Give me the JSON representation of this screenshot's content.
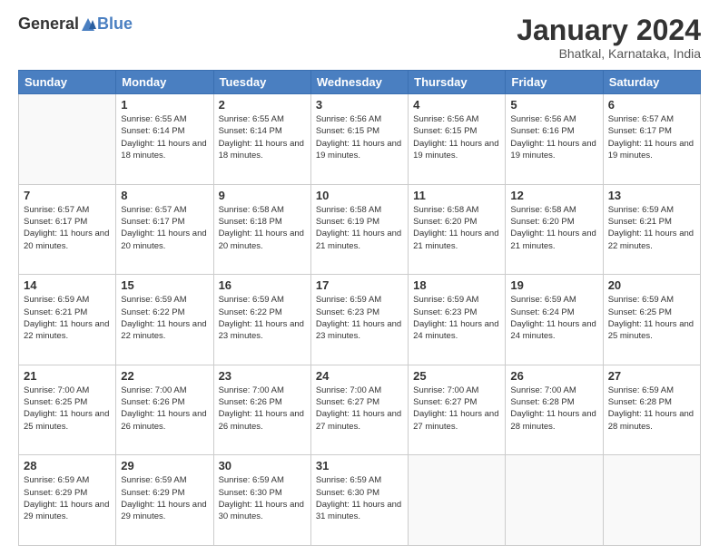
{
  "header": {
    "logo_general": "General",
    "logo_blue": "Blue",
    "month_title": "January 2024",
    "subtitle": "Bhatkal, Karnataka, India"
  },
  "weekdays": [
    "Sunday",
    "Monday",
    "Tuesday",
    "Wednesday",
    "Thursday",
    "Friday",
    "Saturday"
  ],
  "weeks": [
    [
      {
        "day": "",
        "sunrise": "",
        "sunset": "",
        "daylight": ""
      },
      {
        "day": "1",
        "sunrise": "Sunrise: 6:55 AM",
        "sunset": "Sunset: 6:14 PM",
        "daylight": "Daylight: 11 hours and 18 minutes."
      },
      {
        "day": "2",
        "sunrise": "Sunrise: 6:55 AM",
        "sunset": "Sunset: 6:14 PM",
        "daylight": "Daylight: 11 hours and 18 minutes."
      },
      {
        "day": "3",
        "sunrise": "Sunrise: 6:56 AM",
        "sunset": "Sunset: 6:15 PM",
        "daylight": "Daylight: 11 hours and 19 minutes."
      },
      {
        "day": "4",
        "sunrise": "Sunrise: 6:56 AM",
        "sunset": "Sunset: 6:15 PM",
        "daylight": "Daylight: 11 hours and 19 minutes."
      },
      {
        "day": "5",
        "sunrise": "Sunrise: 6:56 AM",
        "sunset": "Sunset: 6:16 PM",
        "daylight": "Daylight: 11 hours and 19 minutes."
      },
      {
        "day": "6",
        "sunrise": "Sunrise: 6:57 AM",
        "sunset": "Sunset: 6:17 PM",
        "daylight": "Daylight: 11 hours and 19 minutes."
      }
    ],
    [
      {
        "day": "7",
        "sunrise": "Sunrise: 6:57 AM",
        "sunset": "Sunset: 6:17 PM",
        "daylight": "Daylight: 11 hours and 20 minutes."
      },
      {
        "day": "8",
        "sunrise": "Sunrise: 6:57 AM",
        "sunset": "Sunset: 6:17 PM",
        "daylight": "Daylight: 11 hours and 20 minutes."
      },
      {
        "day": "9",
        "sunrise": "Sunrise: 6:58 AM",
        "sunset": "Sunset: 6:18 PM",
        "daylight": "Daylight: 11 hours and 20 minutes."
      },
      {
        "day": "10",
        "sunrise": "Sunrise: 6:58 AM",
        "sunset": "Sunset: 6:19 PM",
        "daylight": "Daylight: 11 hours and 21 minutes."
      },
      {
        "day": "11",
        "sunrise": "Sunrise: 6:58 AM",
        "sunset": "Sunset: 6:20 PM",
        "daylight": "Daylight: 11 hours and 21 minutes."
      },
      {
        "day": "12",
        "sunrise": "Sunrise: 6:58 AM",
        "sunset": "Sunset: 6:20 PM",
        "daylight": "Daylight: 11 hours and 21 minutes."
      },
      {
        "day": "13",
        "sunrise": "Sunrise: 6:59 AM",
        "sunset": "Sunset: 6:21 PM",
        "daylight": "Daylight: 11 hours and 22 minutes."
      }
    ],
    [
      {
        "day": "14",
        "sunrise": "Sunrise: 6:59 AM",
        "sunset": "Sunset: 6:21 PM",
        "daylight": "Daylight: 11 hours and 22 minutes."
      },
      {
        "day": "15",
        "sunrise": "Sunrise: 6:59 AM",
        "sunset": "Sunset: 6:22 PM",
        "daylight": "Daylight: 11 hours and 22 minutes."
      },
      {
        "day": "16",
        "sunrise": "Sunrise: 6:59 AM",
        "sunset": "Sunset: 6:22 PM",
        "daylight": "Daylight: 11 hours and 23 minutes."
      },
      {
        "day": "17",
        "sunrise": "Sunrise: 6:59 AM",
        "sunset": "Sunset: 6:23 PM",
        "daylight": "Daylight: 11 hours and 23 minutes."
      },
      {
        "day": "18",
        "sunrise": "Sunrise: 6:59 AM",
        "sunset": "Sunset: 6:23 PM",
        "daylight": "Daylight: 11 hours and 24 minutes."
      },
      {
        "day": "19",
        "sunrise": "Sunrise: 6:59 AM",
        "sunset": "Sunset: 6:24 PM",
        "daylight": "Daylight: 11 hours and 24 minutes."
      },
      {
        "day": "20",
        "sunrise": "Sunrise: 6:59 AM",
        "sunset": "Sunset: 6:25 PM",
        "daylight": "Daylight: 11 hours and 25 minutes."
      }
    ],
    [
      {
        "day": "21",
        "sunrise": "Sunrise: 7:00 AM",
        "sunset": "Sunset: 6:25 PM",
        "daylight": "Daylight: 11 hours and 25 minutes."
      },
      {
        "day": "22",
        "sunrise": "Sunrise: 7:00 AM",
        "sunset": "Sunset: 6:26 PM",
        "daylight": "Daylight: 11 hours and 26 minutes."
      },
      {
        "day": "23",
        "sunrise": "Sunrise: 7:00 AM",
        "sunset": "Sunset: 6:26 PM",
        "daylight": "Daylight: 11 hours and 26 minutes."
      },
      {
        "day": "24",
        "sunrise": "Sunrise: 7:00 AM",
        "sunset": "Sunset: 6:27 PM",
        "daylight": "Daylight: 11 hours and 27 minutes."
      },
      {
        "day": "25",
        "sunrise": "Sunrise: 7:00 AM",
        "sunset": "Sunset: 6:27 PM",
        "daylight": "Daylight: 11 hours and 27 minutes."
      },
      {
        "day": "26",
        "sunrise": "Sunrise: 7:00 AM",
        "sunset": "Sunset: 6:28 PM",
        "daylight": "Daylight: 11 hours and 28 minutes."
      },
      {
        "day": "27",
        "sunrise": "Sunrise: 6:59 AM",
        "sunset": "Sunset: 6:28 PM",
        "daylight": "Daylight: 11 hours and 28 minutes."
      }
    ],
    [
      {
        "day": "28",
        "sunrise": "Sunrise: 6:59 AM",
        "sunset": "Sunset: 6:29 PM",
        "daylight": "Daylight: 11 hours and 29 minutes."
      },
      {
        "day": "29",
        "sunrise": "Sunrise: 6:59 AM",
        "sunset": "Sunset: 6:29 PM",
        "daylight": "Daylight: 11 hours and 29 minutes."
      },
      {
        "day": "30",
        "sunrise": "Sunrise: 6:59 AM",
        "sunset": "Sunset: 6:30 PM",
        "daylight": "Daylight: 11 hours and 30 minutes."
      },
      {
        "day": "31",
        "sunrise": "Sunrise: 6:59 AM",
        "sunset": "Sunset: 6:30 PM",
        "daylight": "Daylight: 11 hours and 31 minutes."
      },
      {
        "day": "",
        "sunrise": "",
        "sunset": "",
        "daylight": ""
      },
      {
        "day": "",
        "sunrise": "",
        "sunset": "",
        "daylight": ""
      },
      {
        "day": "",
        "sunrise": "",
        "sunset": "",
        "daylight": ""
      }
    ]
  ]
}
